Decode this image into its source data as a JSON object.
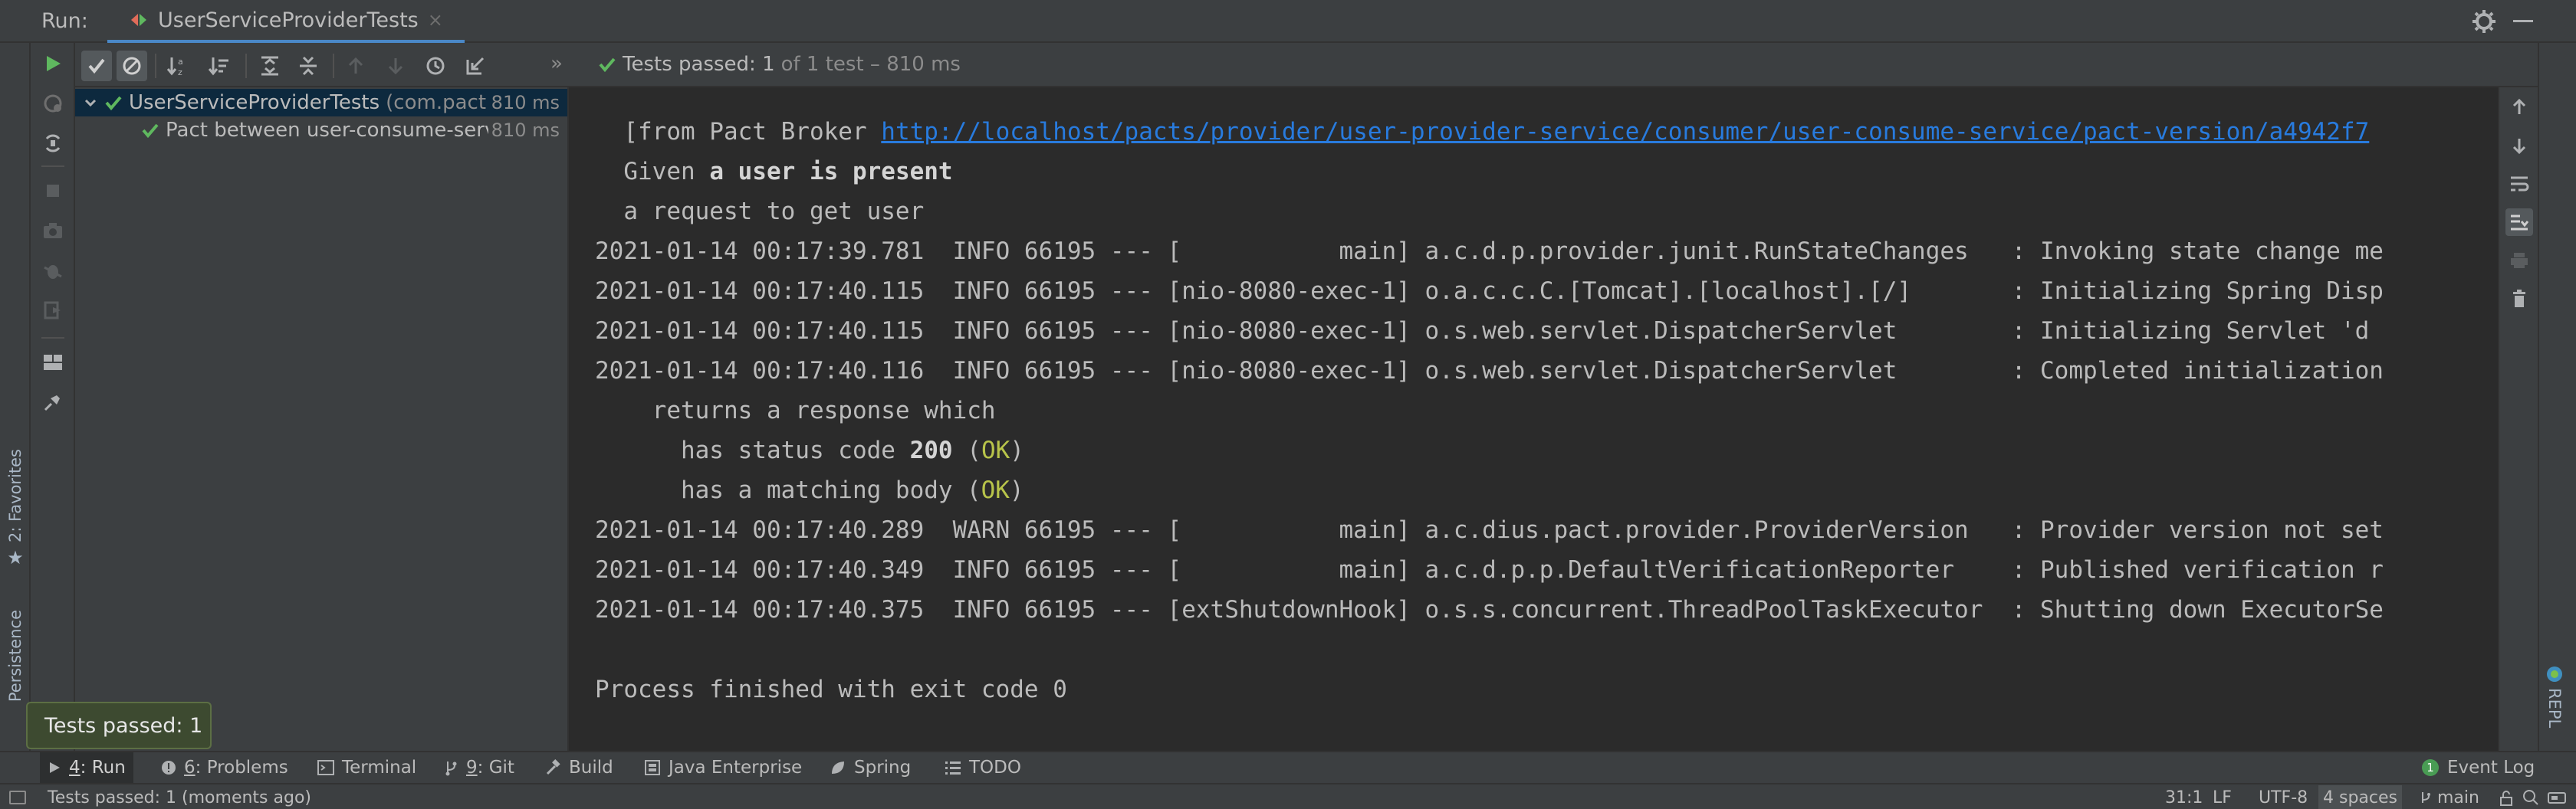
{
  "header": {
    "run_label": "Run:",
    "tab_title": "UserServiceProviderTests",
    "tab_close": "×"
  },
  "test_toolbar": {
    "status_passed": "Tests passed: 1",
    "status_details": "of 1 test – 810 ms",
    "more": "»"
  },
  "test_tree": {
    "rows": [
      {
        "name": "UserServiceProviderTests",
        "package": "(com.pact",
        "time": "810 ms",
        "status": "passed"
      },
      {
        "name": "Pact between user-consume-serv",
        "time": "810 ms",
        "status": "passed"
      }
    ]
  },
  "console": {
    "pact_prefix": "  [from Pact Broker ",
    "pact_url": "http://localhost/pacts/provider/user-provider-service/consumer/user-consume-service/pact-version/a4942f7",
    "given_prefix": "  Given ",
    "given_state": "a user is present",
    "request": "  a request to get user",
    "log1": "2021-01-14 00:17:39.781  INFO 66195 --- [           main] a.c.d.p.provider.junit.RunStateChanges   : Invoking state change me",
    "log2": "2021-01-14 00:17:40.115  INFO 66195 --- [nio-8080-exec-1] o.a.c.c.C.[Tomcat].[localhost].[/]       : Initializing Spring Disp",
    "log3": "2021-01-14 00:17:40.115  INFO 66195 --- [nio-8080-exec-1] o.s.web.servlet.DispatcherServlet        : Initializing Servlet 'd",
    "log4": "2021-01-14 00:17:40.116  INFO 66195 --- [nio-8080-exec-1] o.s.web.servlet.DispatcherServlet        : Completed initialization",
    "returns": "    returns a response which",
    "status_prefix": "      has status code ",
    "status_code": "200",
    "body_prefix": "      has a matching body ",
    "ok": "OK",
    "open_paren": " (",
    "close_paren": ")",
    "log5": "2021-01-14 00:17:40.289  WARN 66195 --- [           main] a.c.dius.pact.provider.ProviderVersion   : Provider version not set",
    "log6": "2021-01-14 00:17:40.349  INFO 66195 --- [           main] a.c.d.p.p.DefaultVerificationReporter    : Published verification r",
    "log7": "2021-01-14 00:17:40.375  INFO 66195 --- [extShutdownHook] o.s.s.concurrent.ThreadPoolTaskExecutor  : Shutting down ExecutorSe",
    "finished": "Process finished with exit code 0"
  },
  "left_stripe": {
    "favorites": "2: Favorites",
    "persistence": "Persistence"
  },
  "right_stripe": {
    "repl": "REPL"
  },
  "tool_windows": [
    {
      "num": "4",
      "label": ": Run",
      "icon": "play-icon"
    },
    {
      "num": "6",
      "label": ": Problems",
      "icon": "problems-icon"
    },
    {
      "label": "Terminal",
      "icon": "terminal-icon"
    },
    {
      "num": "9",
      "label": ": Git",
      "icon": "git-icon"
    },
    {
      "label": "Build",
      "icon": "hammer-icon"
    },
    {
      "label": "Java Enterprise",
      "icon": "java-enterprise-icon"
    },
    {
      "label": "Spring",
      "icon": "spring-icon"
    },
    {
      "label": "TODO",
      "icon": "list-icon"
    },
    {
      "label": "Event Log",
      "badge": "1",
      "icon": "event-log-icon"
    }
  ],
  "tooltip": {
    "text": "Tests passed: 1"
  },
  "status_bar": {
    "text": "Tests passed: 1 (moments ago)",
    "position": "31:1",
    "line_sep": "LF",
    "encoding": "UTF-8",
    "indent": "4 spaces",
    "branch": "main"
  },
  "colors": {
    "pass_green": "#5fb85f",
    "link_blue": "#287bde",
    "ok_yellow": "#b8c44a",
    "selection": "#0d293e"
  }
}
